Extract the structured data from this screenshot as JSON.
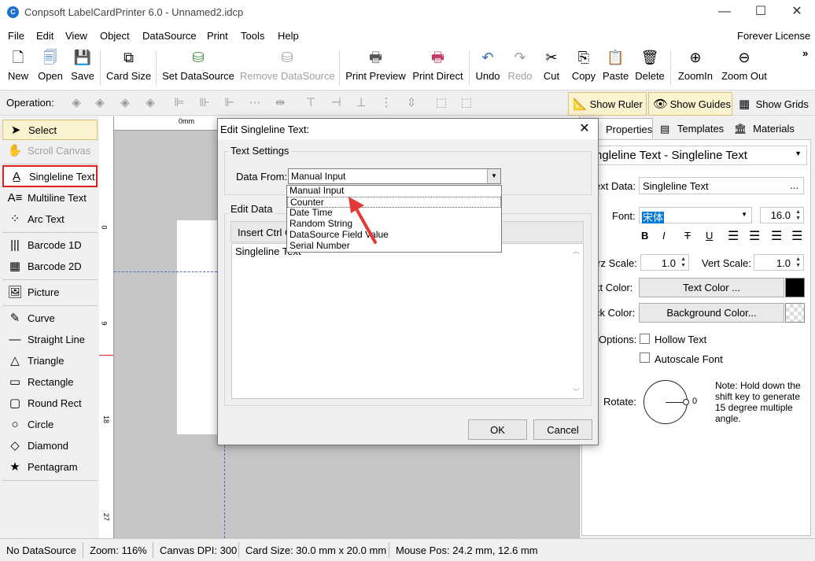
{
  "window": {
    "title": "Conpsoft LabelCardPrinter 6.0 - Unnamed2.idcp",
    "minimize": "—",
    "maximize": "☐",
    "close": "✕"
  },
  "menu": {
    "items": [
      "File",
      "Edit",
      "View",
      "Object",
      "DataSource",
      "Print",
      "Tools",
      "Help"
    ],
    "license": "Forever License"
  },
  "toolbar": {
    "new": "New",
    "open": "Open",
    "save": "Save",
    "card_size": "Card Size",
    "set_datasource": "Set DataSource",
    "remove_datasource": "Remove DataSource",
    "print_preview": "Print Preview",
    "print_direct": "Print Direct",
    "undo": "Undo",
    "redo": "Redo",
    "cut": "Cut",
    "copy": "Copy",
    "paste": "Paste",
    "delete": "Delete",
    "zoom_in": "ZoomIn",
    "zoom_out": "Zoom Out",
    "overflow": "»"
  },
  "operation_bar": {
    "label": "Operation:",
    "show_ruler": "Show Ruler",
    "show_guides": "Show Guides",
    "show_grids": "Show Grids"
  },
  "tools": {
    "select": "Select",
    "scroll_canvas": "Scroll Canvas",
    "singleline_text": "Singleline Text",
    "multiline_text": "Multiline Text",
    "arc_text": "Arc Text",
    "barcode_1d": "Barcode 1D",
    "barcode_2d": "Barcode 2D",
    "picture": "Picture",
    "curve": "Curve",
    "straight_line": "Straight Line",
    "triangle": "Triangle",
    "rectangle": "Rectangle",
    "round_rect": "Round Rect",
    "circle": "Circle",
    "diamond": "Diamond",
    "pentagram": "Pentagram"
  },
  "ruler": {
    "top_unit": "0mm",
    "left_marks": [
      "0",
      "9",
      "18",
      "27"
    ]
  },
  "right_panel": {
    "tabs": {
      "properties": "Properties",
      "templates": "Templates",
      "materials": "Materials"
    },
    "object_selector": "ngleline Text - Singleline Text",
    "text_data_label": "ext Data:",
    "text_data_value": "Singleline Text",
    "text_data_more": "...",
    "font_label": "Font:",
    "font_value": "宋体",
    "font_size": "16.0",
    "horz_scale_label": "orz Scale:",
    "horz_scale": "1.0",
    "vert_scale_label": "Vert Scale:",
    "vert_scale": "1.0",
    "text_color_label": "xt Color:",
    "text_color_button": "Text Color ...",
    "text_color_value": "#000000",
    "back_color_label": "ck Color:",
    "back_color_button": "Background Color...",
    "options_label": "Options:",
    "hollow_text": "Hollow Text",
    "autoscale_font": "Autoscale Font",
    "rotate_label": "Rotate:",
    "rotate_value": "0",
    "rotate_note": "Note: Hold down the shift key to generate 15 degree multiple angle.",
    "format_buttons": [
      "B",
      "I",
      "T",
      "U"
    ]
  },
  "status": {
    "datasource": "No DataSource",
    "zoom": "Zoom: 116%",
    "dpi": "Canvas DPI: 300",
    "card_size": "Card Size: 30.0 mm x 20.0 mm",
    "mouse_pos": "Mouse Pos: 24.2 mm, 12.6 mm"
  },
  "dialog": {
    "title": "Edit Singleline Text:",
    "close": "✕",
    "text_settings_group": "Text Settings",
    "data_from_label": "Data From:",
    "data_from_value": "Manual Input",
    "data_from_options": [
      "Manual Input",
      "Counter",
      "Date Time",
      "Random String",
      "DataSource Field Value",
      "Serial Number"
    ],
    "highlighted_option": "Counter",
    "edit_data_group": "Edit Data",
    "insert_ctrl": "Insert Ctrl C",
    "text_value": "Singleline Text",
    "ok": "OK",
    "cancel": "Cancel"
  },
  "colors": {
    "selection_bg": "#fbf2cf",
    "active_tool_border": "#e02020",
    "annotation_arrow": "#e53935",
    "guide_line": "#5566cc"
  }
}
